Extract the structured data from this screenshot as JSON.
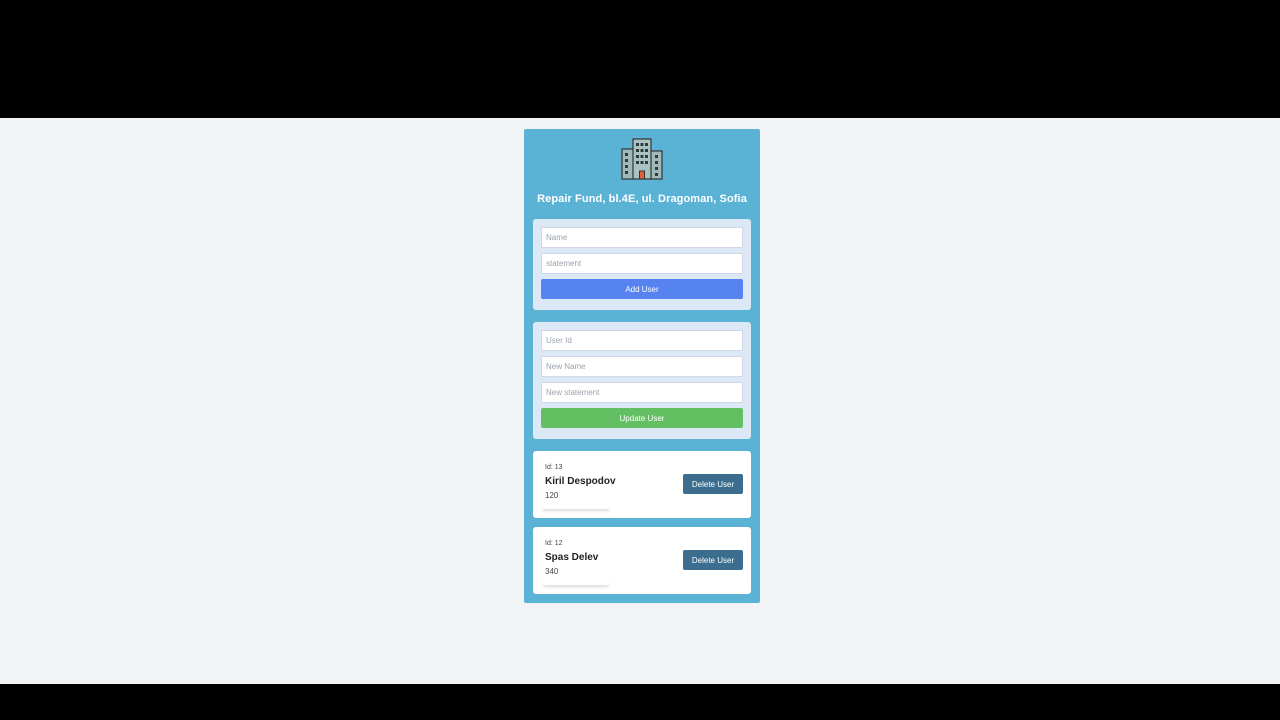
{
  "app": {
    "title": "Repair Fund, bl.4E, ul. Dragoman, Sofia",
    "logo_icon": "building-icon"
  },
  "add_form": {
    "name_placeholder": "Name",
    "statement_placeholder": "statement",
    "button_label": "Add User"
  },
  "update_form": {
    "id_placeholder": "User Id",
    "name_placeholder": "New Name",
    "statement_placeholder": "New statement",
    "button_label": "Update User"
  },
  "users": [
    {
      "id_label": "Id: 13",
      "name": "Kiril Despodov",
      "statement": "120",
      "delete_label": "Delete User"
    },
    {
      "id_label": "Id: 12",
      "name": "Spas Delev",
      "statement": "340",
      "delete_label": "Delete User"
    }
  ],
  "colors": {
    "page_background": "#f2f3f5",
    "card_background": "#5ab2d5",
    "panel_background": "#dde8f6",
    "add_button": "#5683ef",
    "update_button": "#62c063",
    "delete_button": "#3b6e8e"
  }
}
